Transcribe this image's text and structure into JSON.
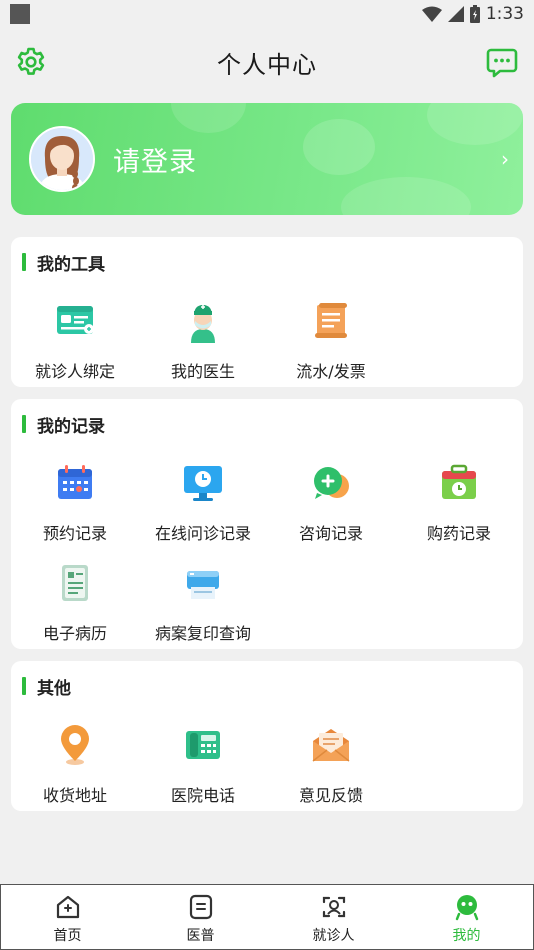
{
  "status_bar": {
    "time": "1:33"
  },
  "header": {
    "title": "个人中心",
    "settings_icon": "gear-icon",
    "message_icon": "message-icon"
  },
  "login": {
    "label": "请登录",
    "arrow": "›"
  },
  "colors": {
    "accent": "#2dbb3d",
    "card_gradient_start": "#5fdc6e",
    "card_gradient_end": "#8ff09c"
  },
  "tools": {
    "title": "我的工具",
    "items": [
      {
        "label": "就诊人绑定",
        "icon": "patient-card-icon"
      },
      {
        "label": "我的医生",
        "icon": "doctor-icon"
      },
      {
        "label": "流水/发票",
        "icon": "invoice-icon"
      }
    ]
  },
  "records": {
    "title": "我的记录",
    "items": [
      {
        "label": "预约记录",
        "icon": "calendar-icon"
      },
      {
        "label": "在线问诊记录",
        "icon": "monitor-clock-icon"
      },
      {
        "label": "咨询记录",
        "icon": "chat-plus-icon"
      },
      {
        "label": "购药记录",
        "icon": "medicine-box-icon"
      },
      {
        "label": "电子病历",
        "icon": "medical-record-icon"
      },
      {
        "label": "病案复印查询",
        "icon": "printer-icon"
      }
    ]
  },
  "other": {
    "title": "其他",
    "items": [
      {
        "label": "收货地址",
        "icon": "location-pin-icon"
      },
      {
        "label": "医院电话",
        "icon": "telephone-icon"
      },
      {
        "label": "意见反馈",
        "icon": "envelope-icon"
      }
    ]
  },
  "bottom_nav": {
    "items": [
      {
        "label": "首页",
        "icon": "home-icon"
      },
      {
        "label": "医普",
        "icon": "article-icon"
      },
      {
        "label": "就诊人",
        "icon": "patient-scan-icon"
      },
      {
        "label": "我的",
        "icon": "profile-face-icon",
        "active": true
      }
    ]
  }
}
